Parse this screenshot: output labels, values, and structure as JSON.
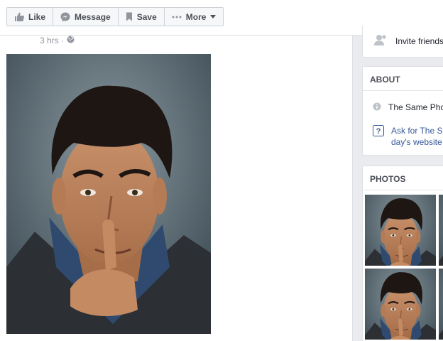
{
  "actions": {
    "like": "Like",
    "message": "Message",
    "save": "Save",
    "more": "More"
  },
  "post": {
    "timestamp": "3 hrs ·"
  },
  "invite": {
    "label": "Invite friends"
  },
  "about": {
    "title": "ABOUT",
    "description": "The Same Photo",
    "ask_line1": "Ask for The Same Photo",
    "ask_line2": "day's website"
  },
  "photos": {
    "title": "PHOTOS"
  },
  "colors": {
    "link": "#365899",
    "border": "#dddfe2",
    "muted": "#90949c",
    "backdrop": "#e9ebee"
  }
}
